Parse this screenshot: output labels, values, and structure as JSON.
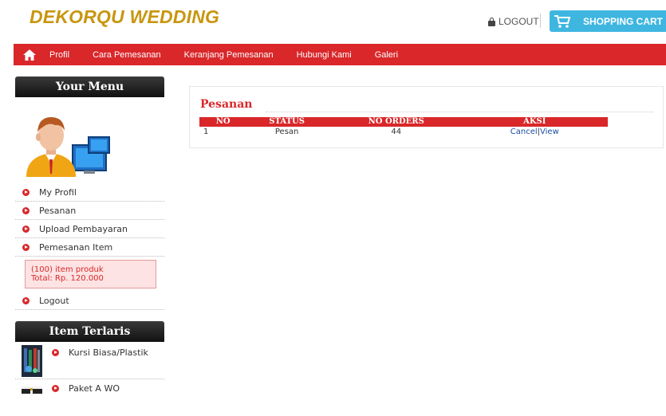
{
  "header": {
    "brand": "DEKORQU WEDDING",
    "logout_label": "LOGOUT",
    "cart_label": "SHOPPING CART"
  },
  "nav": {
    "items": [
      "Profil",
      "Cara Pemesanan",
      "Keranjang Pemesanan",
      "Hubungi Kami",
      "Galeri"
    ]
  },
  "sidebar": {
    "menu_title": "Your Menu",
    "menu_items": [
      "My Profil",
      "Pesanan",
      "Upload Pembayaran",
      "Pemesanan Item"
    ],
    "cart_summary": {
      "items_text": "(100) item produk",
      "total_text": "Total: Rp. 120.000"
    },
    "logout_label": "Logout",
    "bestseller_title": "Item Terlaris",
    "bestsellers": [
      "Kursi Biasa/Plastik",
      "Paket A WO"
    ]
  },
  "main": {
    "title": "Pesanan",
    "columns": [
      "NO",
      "STATUS",
      "NO ORDERS",
      "AKSI"
    ],
    "rows": [
      {
        "no": "1",
        "status": "Pesan",
        "order_no": "44",
        "cancel": "Cancel",
        "sep": "|",
        "view": "View"
      }
    ]
  },
  "colors": {
    "brand": "#c8960f",
    "accent_red": "#d9272a",
    "cart_blue": "#3fb6e0"
  }
}
